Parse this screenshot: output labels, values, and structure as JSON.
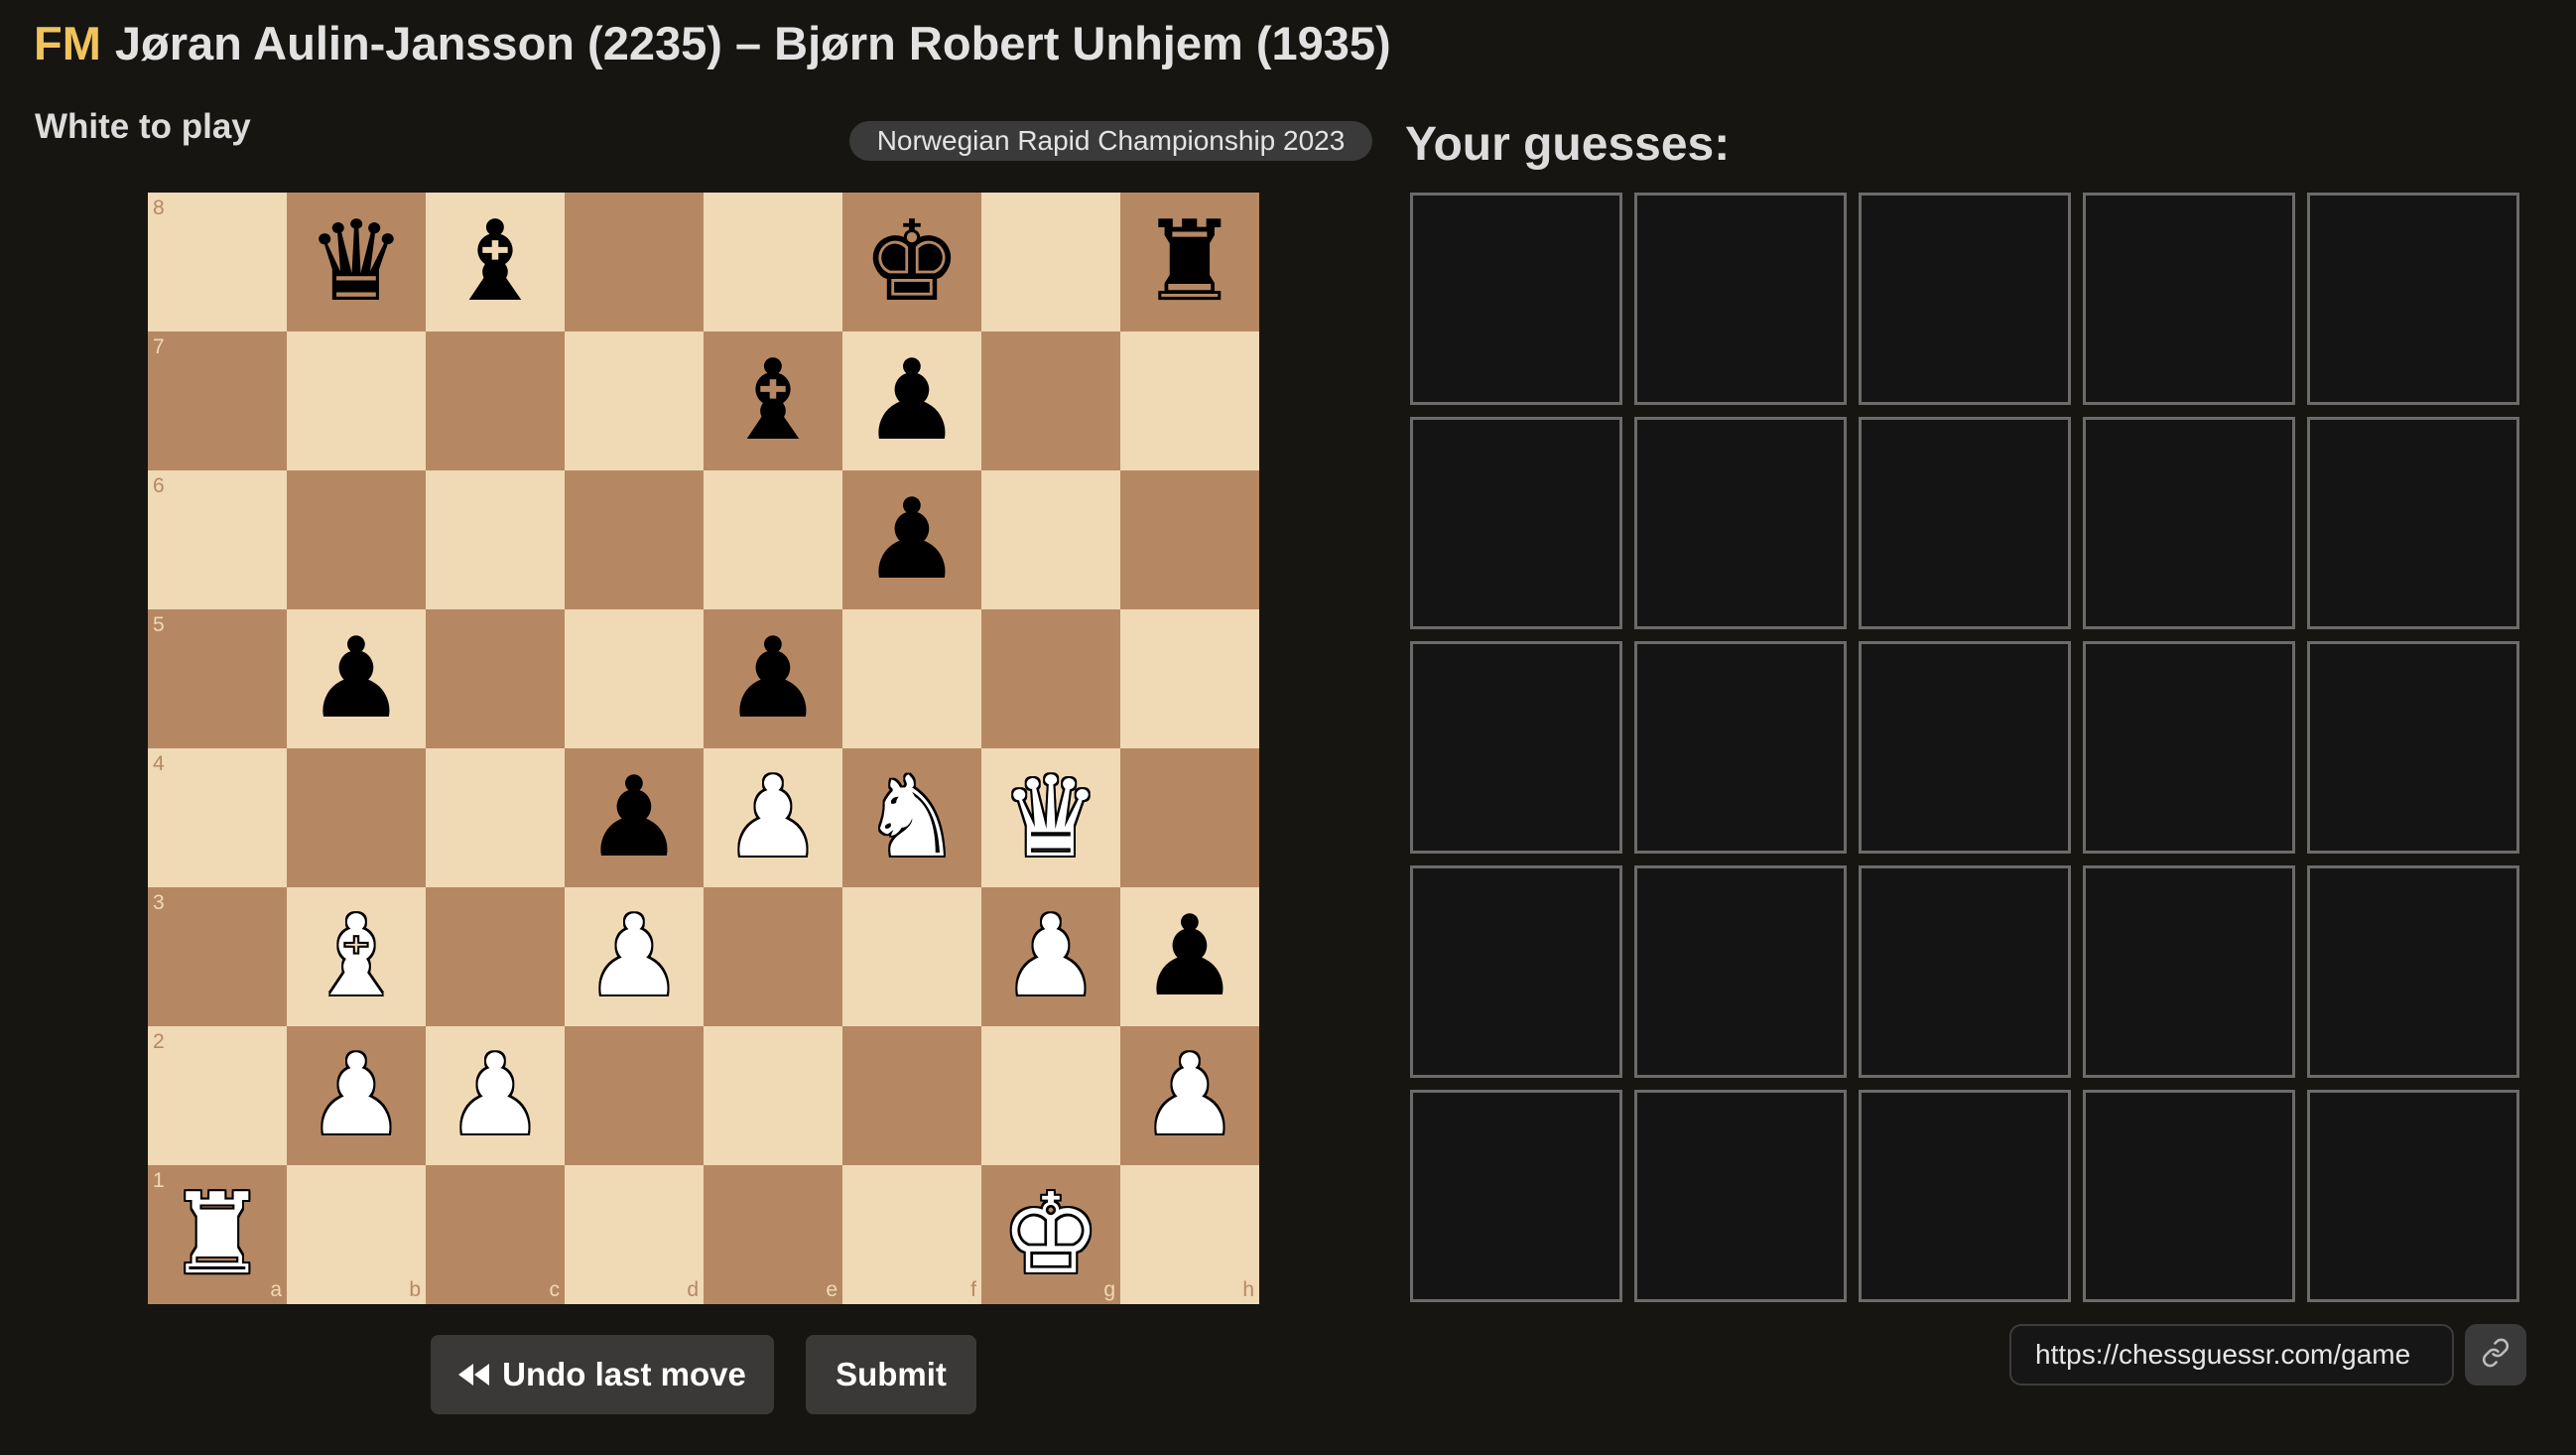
{
  "header": {
    "title_prefix": "FM",
    "title": "Jøran Aulin-Jansson (2235) – Bjørn Robert Unhjem (1935)"
  },
  "status": {
    "to_play": "White to play",
    "event": "Norwegian Rapid Championship 2023"
  },
  "board": {
    "files": [
      "a",
      "b",
      "c",
      "d",
      "e",
      "f",
      "g",
      "h"
    ],
    "ranks": [
      "8",
      "7",
      "6",
      "5",
      "4",
      "3",
      "2",
      "1"
    ],
    "rows": [
      [
        "",
        "bQ",
        "bB",
        "",
        "",
        "bK",
        "",
        "bR"
      ],
      [
        "",
        "",
        "",
        "",
        "bB",
        "bP",
        "",
        ""
      ],
      [
        "",
        "",
        "",
        "",
        "",
        "bP",
        "",
        ""
      ],
      [
        "",
        "bP",
        "",
        "",
        "bP",
        "",
        "",
        ""
      ],
      [
        "",
        "",
        "",
        "bP",
        "wP",
        "wN",
        "wQ",
        ""
      ],
      [
        "",
        "wB",
        "",
        "wP",
        "",
        "",
        "wP",
        "bP"
      ],
      [
        "",
        "wP",
        "wP",
        "",
        "",
        "",
        "",
        "wP"
      ],
      [
        "wR",
        "",
        "",
        "",
        "",
        "",
        "wK",
        ""
      ]
    ],
    "light_color": "#f0d9b5",
    "dark_color": "#b58863"
  },
  "controls": {
    "undo_label": "Undo last move",
    "undo_icon": "rewind-icon",
    "submit_label": "Submit"
  },
  "guesses": {
    "heading": "Your guesses:",
    "rows": 5,
    "cols": 5
  },
  "share": {
    "url": "https://chessguessr.com/game",
    "copy_icon": "link-icon"
  }
}
